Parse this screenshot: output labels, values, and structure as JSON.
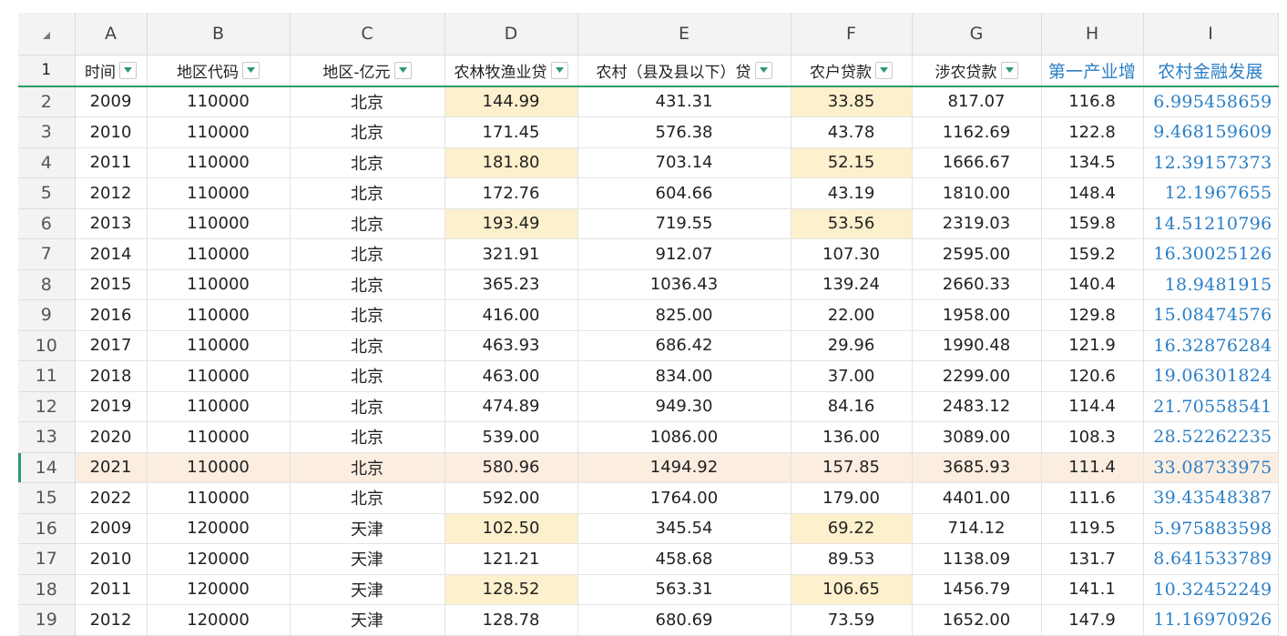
{
  "columns": [
    "A",
    "B",
    "C",
    "D",
    "E",
    "F",
    "G",
    "H",
    "I"
  ],
  "headers": [
    {
      "label": "时间",
      "filter": true
    },
    {
      "label": "地区代码",
      "filter": true
    },
    {
      "label": "地区-亿元",
      "filter": true
    },
    {
      "label": "农林牧渔业贷",
      "filter": true
    },
    {
      "label": "农村（县及县以下）贷",
      "filter": true
    },
    {
      "label": "农户贷款",
      "filter": true
    },
    {
      "label": "涉农贷款",
      "filter": true
    },
    {
      "label": "第一产业增",
      "filter": false
    },
    {
      "label": "农村金融发展",
      "filter": false
    }
  ],
  "highlight_columns": [
    3,
    5
  ],
  "highlight_rows": [
    2,
    4,
    6,
    16,
    18
  ],
  "selected_row": 14,
  "rows": [
    {
      "n": "2",
      "cells": [
        "2009",
        "110000",
        "北京",
        "144.99",
        "431.31",
        "33.85",
        "817.07",
        "116.8",
        "6.995458659"
      ]
    },
    {
      "n": "3",
      "cells": [
        "2010",
        "110000",
        "北京",
        "171.45",
        "576.38",
        "43.78",
        "1162.69",
        "122.8",
        "9.468159609"
      ]
    },
    {
      "n": "4",
      "cells": [
        "2011",
        "110000",
        "北京",
        "181.80",
        "703.14",
        "52.15",
        "1666.67",
        "134.5",
        "12.39157373"
      ]
    },
    {
      "n": "5",
      "cells": [
        "2012",
        "110000",
        "北京",
        "172.76",
        "604.66",
        "43.19",
        "1810.00",
        "148.4",
        "12.1967655"
      ]
    },
    {
      "n": "6",
      "cells": [
        "2013",
        "110000",
        "北京",
        "193.49",
        "719.55",
        "53.56",
        "2319.03",
        "159.8",
        "14.51210796"
      ]
    },
    {
      "n": "7",
      "cells": [
        "2014",
        "110000",
        "北京",
        "321.91",
        "912.07",
        "107.30",
        "2595.00",
        "159.2",
        "16.30025126"
      ]
    },
    {
      "n": "8",
      "cells": [
        "2015",
        "110000",
        "北京",
        "365.23",
        "1036.43",
        "139.24",
        "2660.33",
        "140.4",
        "18.9481915"
      ]
    },
    {
      "n": "9",
      "cells": [
        "2016",
        "110000",
        "北京",
        "416.00",
        "825.00",
        "22.00",
        "1958.00",
        "129.8",
        "15.08474576"
      ]
    },
    {
      "n": "10",
      "cells": [
        "2017",
        "110000",
        "北京",
        "463.93",
        "686.42",
        "29.96",
        "1990.48",
        "121.9",
        "16.32876284"
      ]
    },
    {
      "n": "11",
      "cells": [
        "2018",
        "110000",
        "北京",
        "463.00",
        "834.00",
        "37.00",
        "2299.00",
        "120.6",
        "19.06301824"
      ]
    },
    {
      "n": "12",
      "cells": [
        "2019",
        "110000",
        "北京",
        "474.89",
        "949.30",
        "84.16",
        "2483.12",
        "114.4",
        "21.70558541"
      ]
    },
    {
      "n": "13",
      "cells": [
        "2020",
        "110000",
        "北京",
        "539.00",
        "1086.00",
        "136.00",
        "3089.00",
        "108.3",
        "28.52262235"
      ]
    },
    {
      "n": "14",
      "cells": [
        "2021",
        "110000",
        "北京",
        "580.96",
        "1494.92",
        "157.85",
        "3685.93",
        "111.4",
        "33.08733975"
      ]
    },
    {
      "n": "15",
      "cells": [
        "2022",
        "110000",
        "北京",
        "592.00",
        "1764.00",
        "179.00",
        "4401.00",
        "111.6",
        "39.43548387"
      ]
    },
    {
      "n": "16",
      "cells": [
        "2009",
        "120000",
        "天津",
        "102.50",
        "345.54",
        "69.22",
        "714.12",
        "119.5",
        "5.975883598"
      ]
    },
    {
      "n": "17",
      "cells": [
        "2010",
        "120000",
        "天津",
        "121.21",
        "458.68",
        "89.53",
        "1138.09",
        "131.7",
        "8.641533789"
      ]
    },
    {
      "n": "18",
      "cells": [
        "2011",
        "120000",
        "天津",
        "128.52",
        "563.31",
        "106.65",
        "1456.79",
        "141.1",
        "10.32452249"
      ]
    },
    {
      "n": "19",
      "cells": [
        "2012",
        "120000",
        "天津",
        "128.78",
        "680.69",
        "73.59",
        "1652.00",
        "147.9",
        "11.16970926"
      ]
    }
  ],
  "colors": {
    "highlight": "#fdf0cd",
    "selected_row": "#fbede0",
    "header_underline": "#2e9a6a",
    "serif_text": "#2b7fc6"
  }
}
